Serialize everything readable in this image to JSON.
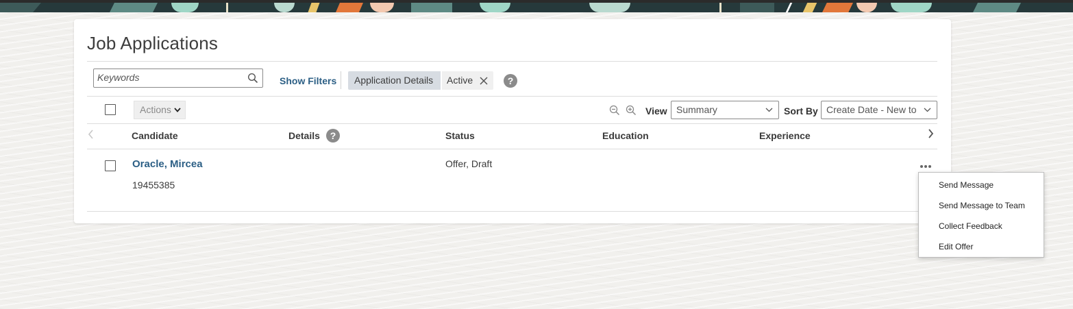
{
  "header": {
    "colors": {
      "banner_base": "#26393b",
      "accent_orange": "#e2773a",
      "accent_mint": "#9fd6c6",
      "accent_yellow": "#e8c46a"
    }
  },
  "page": {
    "title": "Job Applications"
  },
  "toolbar": {
    "search_placeholder": "Keywords",
    "show_filters": "Show Filters",
    "filter_chip_label": "Application Details",
    "filter_chip_value": "Active",
    "help_glyph": "?"
  },
  "list_controls": {
    "actions_label": "Actions",
    "view_label": "View",
    "view_value": "Summary",
    "sort_label": "Sort By",
    "sort_value": "Create Date - New to"
  },
  "table": {
    "columns": [
      "Candidate",
      "Details",
      "Status",
      "Education",
      "Experience"
    ],
    "details_help_glyph": "?",
    "rows": [
      {
        "candidate_name": "Oracle, Mircea",
        "candidate_id": "19455385",
        "status": "Offer, Draft",
        "education": "",
        "experience": ""
      }
    ]
  },
  "row_menu": {
    "items": [
      "Send Message",
      "Send Message to Team",
      "Collect Feedback",
      "Edit Offer"
    ]
  },
  "colors": {
    "link": "#2c5f85",
    "chip_bg": "#d7dce2",
    "help_bg": "#8b8b8b"
  }
}
